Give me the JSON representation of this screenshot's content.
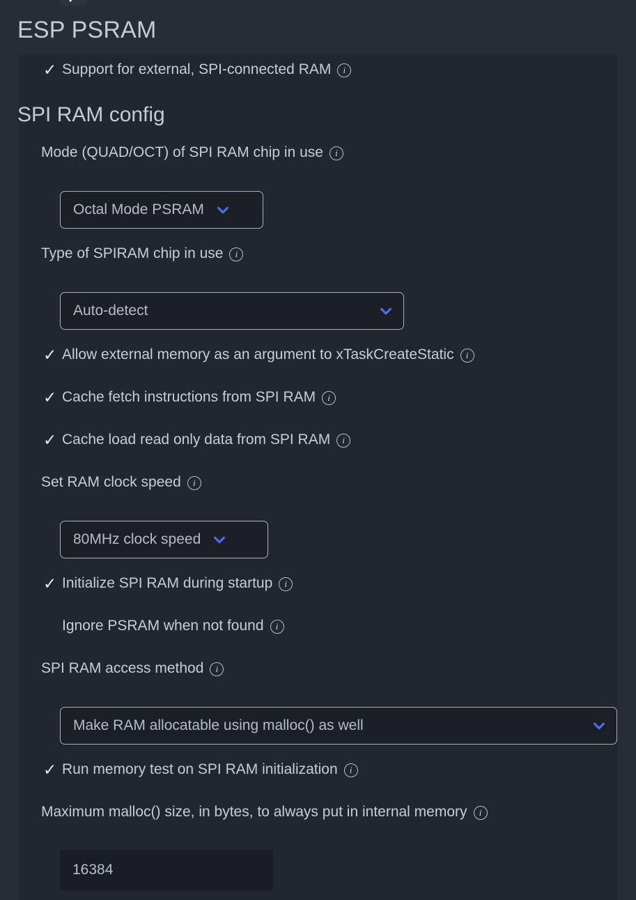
{
  "page": {
    "title": "ESP PSRAM",
    "accent_color": "#4c6ef5",
    "panel_background": "#22262e",
    "window_background": "#282c36",
    "text_color": "#c8ccd4"
  },
  "top_clipped_control": {
    "name": "clipped-checkbox",
    "icon": "check-icon",
    "checked": true
  },
  "icons": {
    "info": "info-icon",
    "check": "check-icon",
    "chevron_down": "chevron-down-icon"
  },
  "glyphs": {
    "check": "✓",
    "info_letter": "i"
  },
  "top_option": {
    "label": "Support for external, SPI-connected RAM",
    "checked": true,
    "info": true
  },
  "section": {
    "heading": "SPI RAM config"
  },
  "items": {
    "mode_label": "Mode (QUAD/OCT) of SPI RAM chip in use",
    "mode_value": "Octal Mode PSRAM",
    "type_label": "Type of SPIRAM chip in use",
    "type_value": "Auto-detect",
    "allow_external_memory": "Allow external memory as an argument to xTaskCreateStatic",
    "cache_fetch_instructions": "Cache fetch instructions from SPI RAM",
    "cache_load_readonly": "Cache load read only data from SPI RAM",
    "clock_speed_label": "Set RAM clock speed",
    "clock_speed_value": "80MHz clock speed",
    "initialize_spi_ram": "Initialize SPI RAM during startup",
    "ignore_psram": "Ignore PSRAM when not found",
    "access_method_label": "SPI RAM access method",
    "access_method_value": "Make RAM allocatable using malloc() as well",
    "run_memory_test": "Run memory test on SPI RAM initialization",
    "max_malloc_label": "Maximum malloc() size, in bytes, to always put in internal memory",
    "max_malloc_value": "16384"
  },
  "checkbox_states": {
    "top_option": true,
    "allow_external_memory": true,
    "cache_fetch_instructions": true,
    "cache_load_readonly": true,
    "initialize_spi_ram": true,
    "ignore_psram": false,
    "run_memory_test": true
  }
}
